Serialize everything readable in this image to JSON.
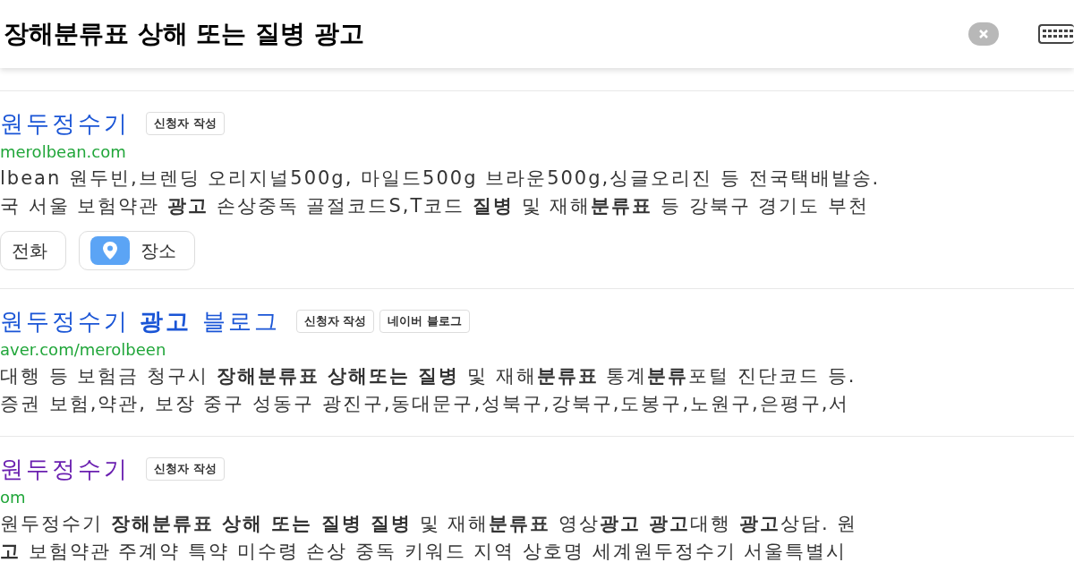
{
  "search": {
    "query": "장해분류표 상해 또는 질병 광고"
  },
  "results": [
    {
      "title": "원두정수기",
      "visited": false,
      "tags": [
        "신청자 작성"
      ],
      "url": "merolbean.com",
      "lines": [
        "lbean 원두빈,브렌딩 오리지널500g, 마일드500g 브라운500g,싱글오리진 등 전국택배발송.",
        "국 서울 보험약관 **광고** 손상중독 골절코드S,T코드 **질병** 및 재해**분류표** 등 강북구 경기도 부천"
      ],
      "actions": [
        {
          "kind": "phone",
          "label": "전화"
        },
        {
          "kind": "place",
          "label": "장소"
        }
      ]
    },
    {
      "title": "원두정수기 **광고** 블로그",
      "visited": false,
      "tags": [
        "신청자 작성",
        "네이버 블로그"
      ],
      "url": "aver.com/merolbeen",
      "lines": [
        "대행 등 보험금 청구시 **장해분류표 상해또는 질병** 및 재해**분류표** 통계**분류**포털 진단코드 등.",
        "증권 보험,약관, 보장 중구 성동구 광진구,동대문구,성북구,강북구,도봉구,노원구,은평구,서"
      ]
    },
    {
      "title": "원두정수기",
      "visited": true,
      "tags": [
        "신청자 작성"
      ],
      "url": "om",
      "lines": [
        "원두정수기 **장해분류표 상해 또는 질병 질병** 및 재해**분류표** 영상**광고 광고**대행 **광고**상담. 원",
        "**고** 보험약관 주계약 특약 미수령 손상 중독 키워드 지역 상호명 세계원두정수기 서울특별시"
      ]
    }
  ]
}
